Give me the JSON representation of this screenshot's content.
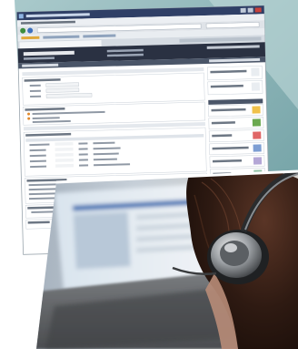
{
  "colors": {
    "background": "#ffffff",
    "panel_teal": "#8fb6b9",
    "panel_teal_light": "#c5dcdd",
    "browser_chrome": "#dfe3e8",
    "app_header": "#2a3142",
    "sidebar_band": "#4a5568",
    "accent_orange": "#e0892b",
    "hair_dark": "#2a1812",
    "laptop_gray": "#6d6f72",
    "skin": "#b88c78"
  },
  "photo": {
    "subject": "person-wearing-headphones-at-laptop"
  }
}
